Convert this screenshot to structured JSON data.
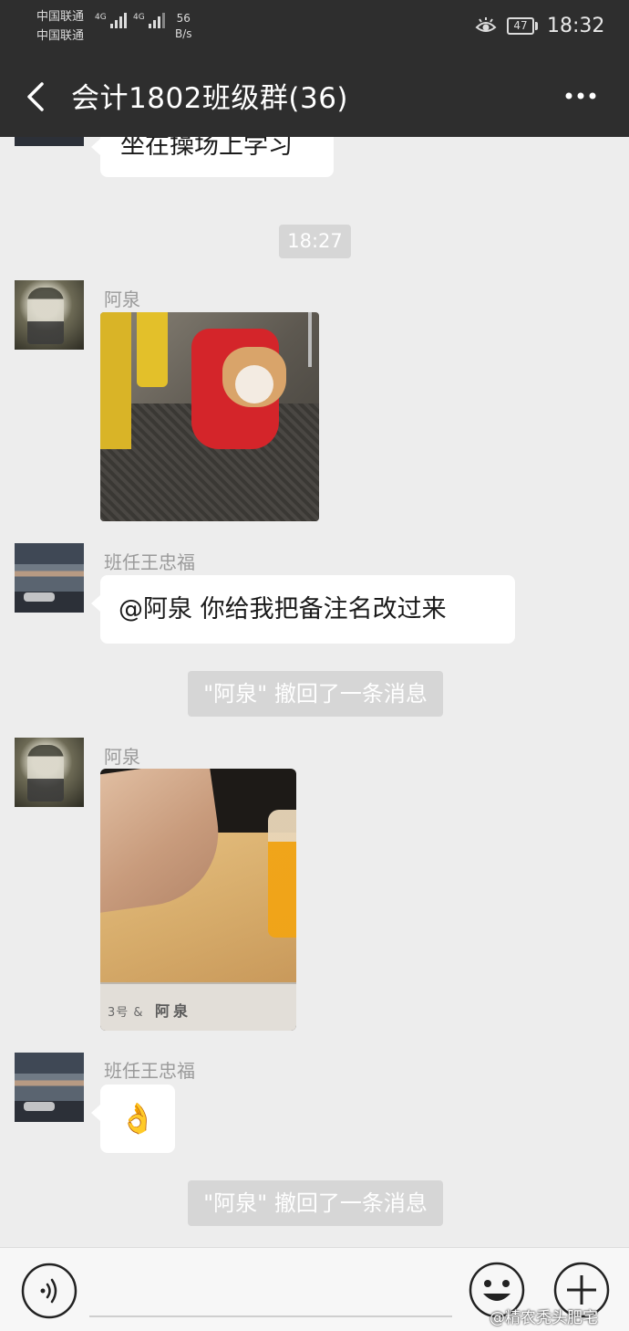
{
  "status_bar": {
    "carrier_1": "中国联通",
    "carrier_2": "中国联通",
    "net_tag_1": "4G",
    "net_tag_2": "4G",
    "net_speed_value": "56",
    "net_speed_unit": "B/s",
    "battery": "47",
    "time": "18:32"
  },
  "header": {
    "title": "会计1802班级群(36)"
  },
  "messages": {
    "partial_text": "坐在操场上学习",
    "time_divider": "18:27",
    "msg1_sender": "阿泉",
    "msg2_sender": "班任王忠福",
    "msg2_text": "@阿泉  你给我把备注名改过来",
    "recall_1": "\"阿泉\" 撤回了一条消息",
    "msg3_sender": "阿泉",
    "msg3_plate_small": "3号 &",
    "msg3_plate_name": "阿泉",
    "msg4_sender": "班任王忠福",
    "msg4_emoji": "👌",
    "recall_2": "\"阿泉\" 撤回了一条消息"
  },
  "input_bar": {
    "watermark": "@精农秃头肥宅"
  },
  "colors": {
    "header_bg": "#2e2e2e",
    "chat_bg": "#ededed",
    "bubble_bg": "#ffffff",
    "system_pill": "#d6d6d6"
  }
}
